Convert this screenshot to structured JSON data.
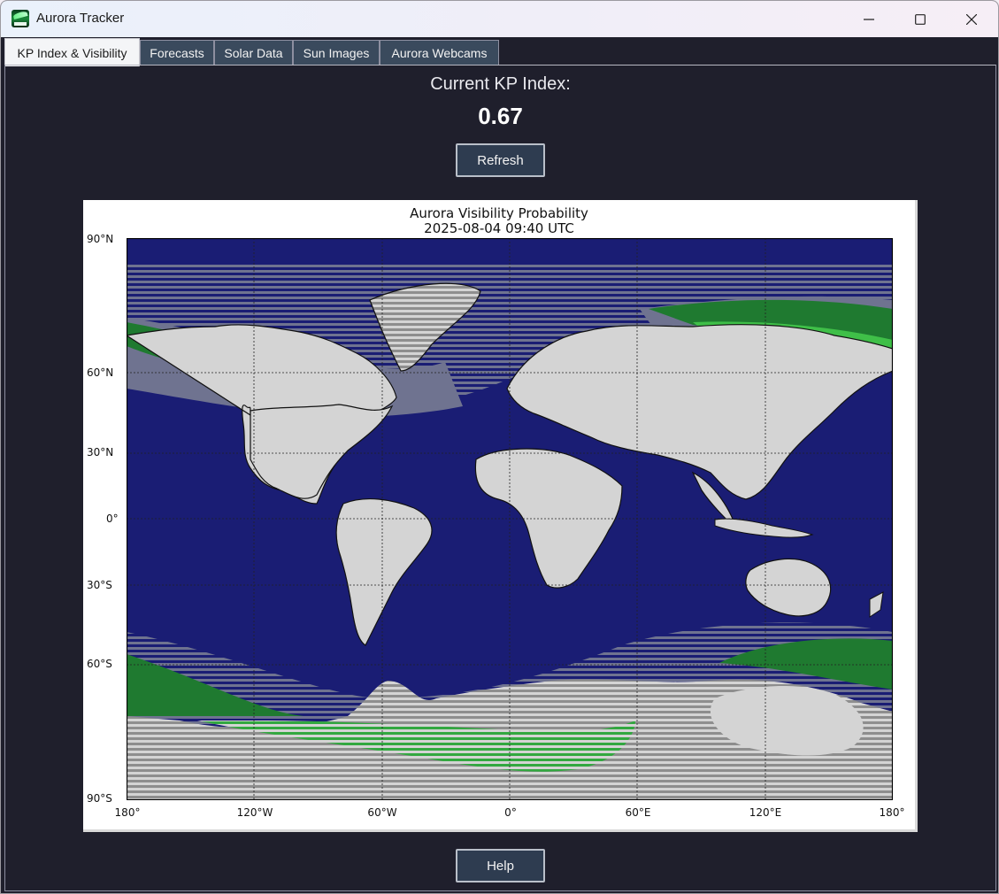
{
  "window": {
    "title": "Aurora Tracker",
    "icon": "aurora-app-icon"
  },
  "tabs": [
    {
      "label": "KP Index & Visibility",
      "active": true
    },
    {
      "label": "Forecasts",
      "active": false
    },
    {
      "label": "Solar Data",
      "active": false
    },
    {
      "label": "Sun Images",
      "active": false
    },
    {
      "label": "Aurora Webcams",
      "active": false
    }
  ],
  "kp": {
    "label": "Current KP Index:",
    "value": "0.67"
  },
  "buttons": {
    "refresh": "Refresh",
    "help": "Help"
  },
  "map": {
    "title": "Aurora Visibility Probability",
    "timestamp": "2025-08-04 09:40 UTC",
    "y_ticks": [
      "90°N",
      "60°N",
      "30°N",
      "0°",
      "30°S",
      "60°S",
      "90°S"
    ],
    "x_ticks": [
      "180°",
      "120°W",
      "60°W",
      "0°",
      "60°E",
      "120°E",
      "180°"
    ],
    "colors": {
      "ocean": "#1a1d74",
      "land": "#d4d4d4",
      "probability_low": "#6f7390",
      "probability_mid": "#8c8c8c",
      "probability_high": "#2e9a3c",
      "probability_peak": "#3fc648"
    }
  }
}
